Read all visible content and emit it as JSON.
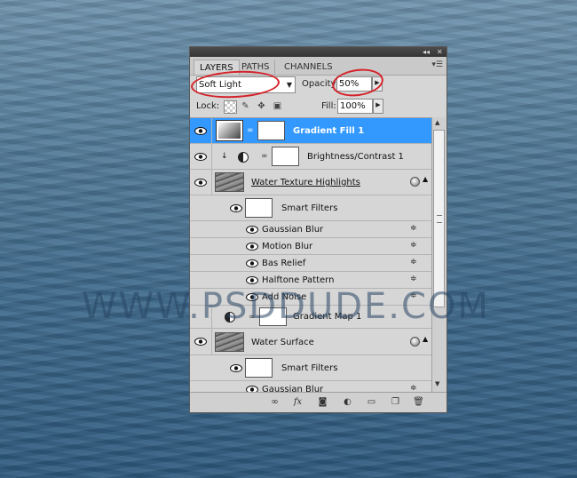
{
  "watermark": "WWW.PSDDUDE.COM",
  "panel": {
    "tabs": [
      "LAYERS",
      "PATHS",
      "CHANNELS"
    ],
    "blend_mode": "Soft Light",
    "opacity_label": "Opacity:",
    "opacity_value": "50%",
    "lock_label": "Lock:",
    "fill_label": "Fill:",
    "fill_value": "100%",
    "layers": [
      {
        "name": "Gradient Fill 1",
        "selected": true
      },
      {
        "name": "Brightness/Contrast 1"
      },
      {
        "name": "Water Texture Highlights"
      },
      {
        "name": "Smart Filters"
      },
      {
        "name": "Gaussian Blur"
      },
      {
        "name": "Motion Blur"
      },
      {
        "name": "Bas Relief"
      },
      {
        "name": "Halftone Pattern"
      },
      {
        "name": "Add Noise"
      },
      {
        "name": "Gradient Map 1"
      },
      {
        "name": "Water Surface"
      },
      {
        "name": "Smart Filters"
      },
      {
        "name": "Gaussian Blur"
      }
    ],
    "footer_icons": [
      "link-icon",
      "fx-icon",
      "mask-icon",
      "adjustment-icon",
      "group-icon",
      "new-layer-icon",
      "trash-icon"
    ]
  },
  "colors": {
    "selection": "#3399ff",
    "annotation": "#d4232a"
  }
}
